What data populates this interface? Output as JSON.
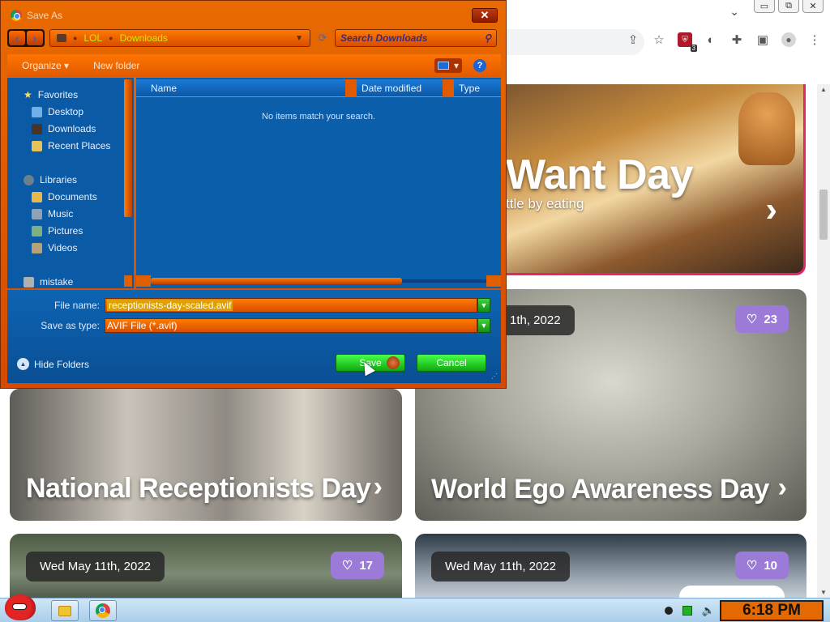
{
  "browser": {
    "window_buttons": [
      "▭",
      "⧉",
      "✕"
    ],
    "tab_chevron": "⌄",
    "toolbar_icons": [
      "share-icon",
      "star-icon",
      "ublock-shield-icon",
      "extension-icon",
      "puzzle-icon",
      "sidebar-icon",
      "profile-icon",
      "menu-icon"
    ],
    "shield_badge": "3"
  },
  "page": {
    "top_card": {
      "title": "Want Day",
      "subtitle": "ttle by eating"
    },
    "cards": [
      {
        "id": "ego",
        "date": "1th, 2022",
        "likes": "23",
        "title": "World Ego Awareness Day"
      },
      {
        "id": "receptionists",
        "title": "National Receptionists Day"
      },
      {
        "id": "bottom-left",
        "date": "Wed May 11th, 2022",
        "likes": "17"
      },
      {
        "id": "bottom-right",
        "date": "Wed May 11th, 2022",
        "likes": "10"
      }
    ],
    "arrow_glyph": "›"
  },
  "dialog": {
    "title": "Save As",
    "close_glyph": "✕",
    "breadcrumb": [
      "LOL",
      "Downloads"
    ],
    "search_placeholder": "Search Downloads",
    "toolbar": {
      "organize": "Organize ▾",
      "new_folder": "New folder",
      "help": "?"
    },
    "nav": {
      "favorites": "Favorites",
      "favorites_items": [
        "Desktop",
        "Downloads",
        "Recent Places"
      ],
      "libraries": "Libraries",
      "libraries_items": [
        "Documents",
        "Music",
        "Pictures",
        "Videos"
      ],
      "homegroup": "mistake"
    },
    "columns": [
      "Name",
      "Date modified",
      "Type"
    ],
    "empty_message": "No items match your search.",
    "file_name_label": "File name:",
    "file_name_value": "receptionists-day-scaled.avif",
    "save_type_label": "Save as type:",
    "save_type_value": "AVIF File (*.avif)",
    "hide_folders": "Hide Folders",
    "save_label": "Save",
    "cancel_label": "Cancel"
  },
  "taskbar": {
    "clock": "6:18 PM"
  },
  "colors": {
    "dialog_orange": "#e86a00",
    "dialog_blue": "#0b5ea9",
    "button_green": "#1fc51f",
    "like_purple": "#9b7ad8",
    "card_accent": "#e0276b"
  }
}
